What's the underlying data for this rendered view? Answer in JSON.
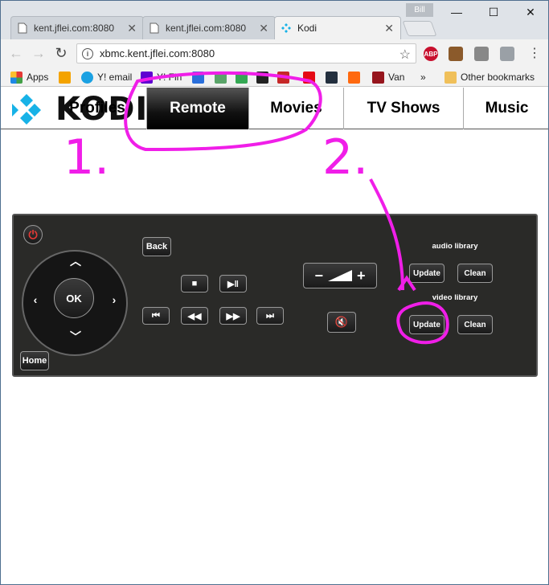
{
  "browser": {
    "tabs": [
      {
        "title": "kent.jflei.com:8080"
      },
      {
        "title": "kent.jflei.com:8080"
      },
      {
        "title": "Kodi"
      }
    ],
    "profile_name": "Bill",
    "url": "xbmc.kent.jflei.com:8080",
    "extensions": [
      "ABP"
    ],
    "bookmarks": {
      "apps": "Apps",
      "yemail": "Y! email",
      "yfin": "Y! Fin",
      "van": "Van",
      "more": "»",
      "other": "Other bookmarks"
    }
  },
  "kodi": {
    "logo_text": "KODI",
    "nav": [
      "Profiles",
      "Remote",
      "Movies",
      "TV Shows",
      "Music"
    ],
    "remote": {
      "back": "Back",
      "ok": "OK",
      "home": "Home",
      "audio_library_label": "audio library",
      "video_library_label": "video library",
      "update": "Update",
      "clean": "Clean"
    }
  },
  "annotations": [
    "1.",
    "2."
  ]
}
